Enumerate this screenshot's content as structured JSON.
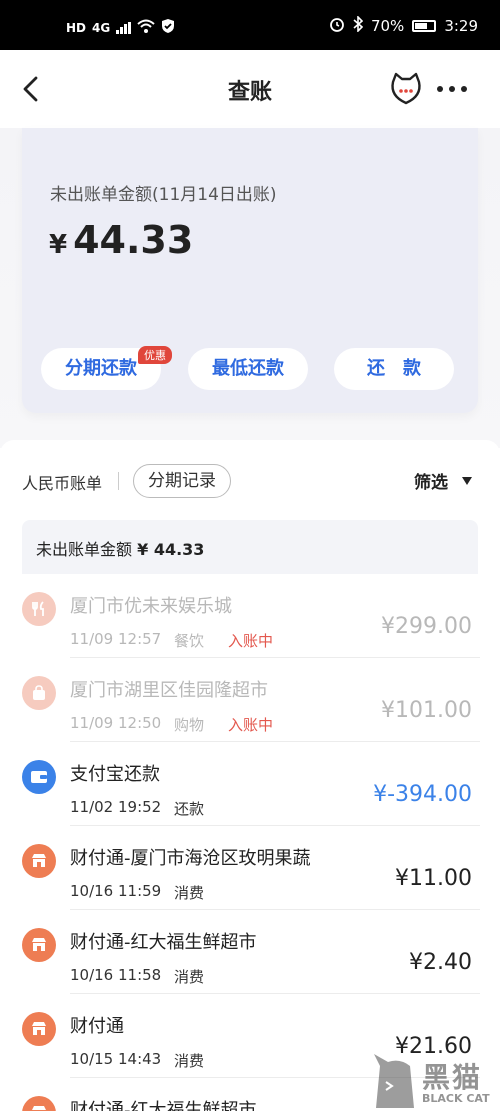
{
  "status_bar": {
    "hd": "HD",
    "network": "4G",
    "battery": "70%",
    "time": "3:29"
  },
  "nav": {
    "title": "查账"
  },
  "bill": {
    "label": "未出账单金额(11月14日出账)",
    "currency": "¥",
    "amount": "44.33",
    "buttons": {
      "installment": "分期还款",
      "installment_badge": "优惠",
      "minimum": "最低还款",
      "repay": "还　款"
    }
  },
  "filter": {
    "rmb_label": "人民币账单",
    "installment_records": "分期记录",
    "filter_label": "筛选"
  },
  "summary": {
    "label": "未出账单金额",
    "amount": "¥ 44.33"
  },
  "transactions": [
    {
      "name": "厦门市优未来娱乐城",
      "time": "11/09 12:57",
      "category": "餐饮",
      "status": "入账中",
      "amount": "¥299.00",
      "icon": "fork-knife-icon",
      "icon_color": "#f6cbbf",
      "faded": true
    },
    {
      "name": "厦门市湖里区佳园隆超市",
      "time": "11/09 12:50",
      "category": "购物",
      "status": "入账中",
      "amount": "¥101.00",
      "icon": "shopping-bag-icon",
      "icon_color": "#f6cbbf",
      "faded": true
    },
    {
      "name": "支付宝还款",
      "time": "11/02 19:52",
      "category": "还款",
      "status": "",
      "amount": "¥-394.00",
      "icon": "wallet-icon",
      "icon_color": "#3b82e8",
      "amount_color": "#3b82e8",
      "faded": false
    },
    {
      "name": "财付通-厦门市海沧区玫明果蔬",
      "time": "10/16 11:59",
      "category": "消费",
      "status": "",
      "amount": "¥11.00",
      "icon": "store-icon",
      "icon_color": "#ee7d53",
      "faded": false
    },
    {
      "name": "财付通-红大福生鲜超市",
      "time": "10/16 11:58",
      "category": "消费",
      "status": "",
      "amount": "¥2.40",
      "icon": "store-icon",
      "icon_color": "#ee7d53",
      "faded": false
    },
    {
      "name": "财付通",
      "time": "10/15 14:43",
      "category": "消费",
      "status": "",
      "amount": "¥21.60",
      "icon": "store-icon",
      "icon_color": "#ee7d53",
      "faded": false
    },
    {
      "name": "财付通-红大福生鲜超市",
      "time": "",
      "category": "",
      "status": "",
      "amount": "",
      "icon": "store-icon",
      "icon_color": "#ee7d53",
      "faded": false
    }
  ],
  "watermark": {
    "text": "黑猫",
    "sub": "BLACK CAT"
  }
}
